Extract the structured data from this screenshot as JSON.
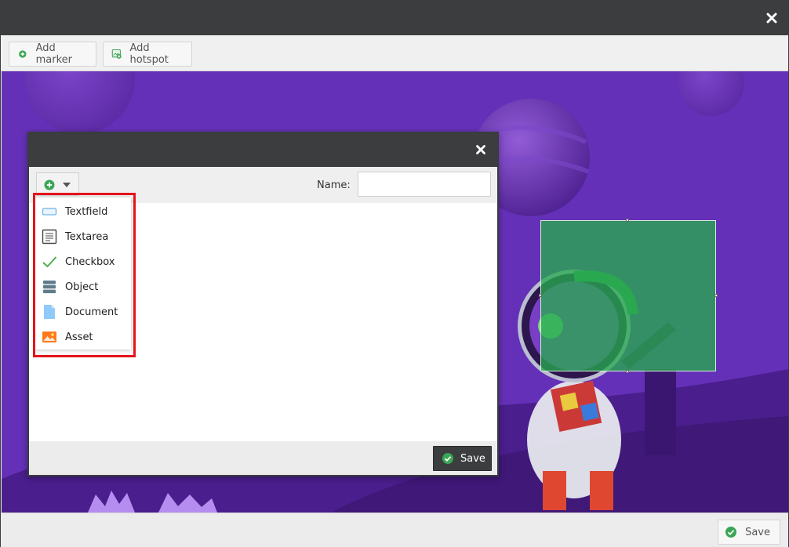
{
  "toolbar": {
    "add_marker_label": "Add marker",
    "add_hotspot_label": "Add hotspot"
  },
  "footer": {
    "save_label": "Save"
  },
  "dialog": {
    "name_label": "Name:",
    "name_value": "",
    "save_label": "Save",
    "menu_items": [
      {
        "label": "Textfield",
        "icon": "textfield-icon"
      },
      {
        "label": "Textarea",
        "icon": "textarea-icon"
      },
      {
        "label": "Checkbox",
        "icon": "checkbox-icon"
      },
      {
        "label": "Object",
        "icon": "object-icon"
      },
      {
        "label": "Document",
        "icon": "document-icon"
      },
      {
        "label": "Asset",
        "icon": "asset-icon"
      }
    ]
  },
  "colors": {
    "titlebar": "#3b3d3f",
    "accent_green": "#2ea84f",
    "highlight_red": "#e4141b",
    "canvas_purple": "#6a2fbf"
  }
}
